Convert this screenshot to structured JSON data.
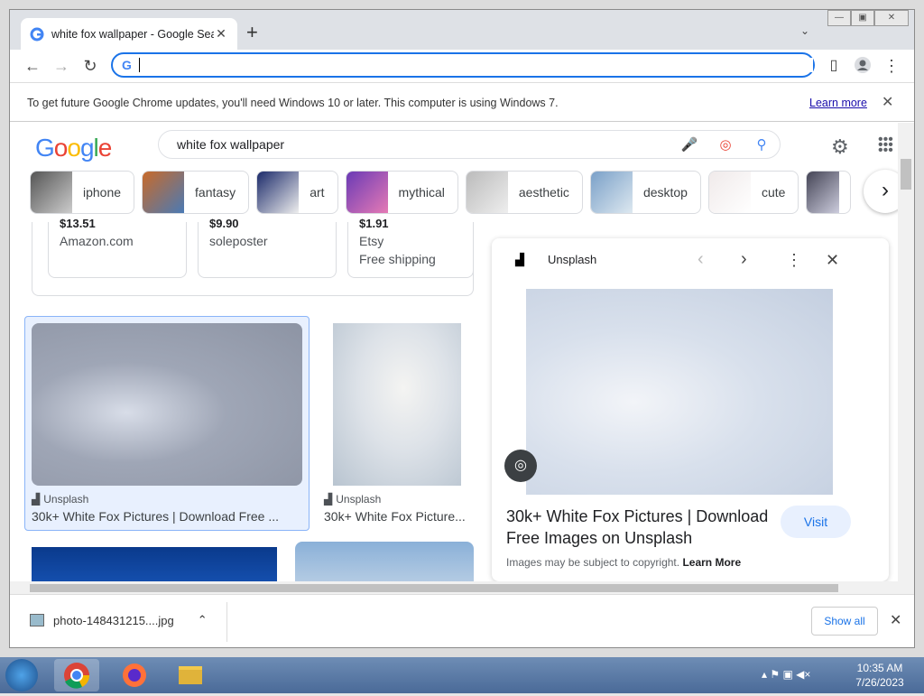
{
  "browser": {
    "tab_title": "white fox wallpaper - Google Sea",
    "omnibox_value": "",
    "infobar_message": "To get future Google Chrome updates, you'll need Windows 10 or later. This computer is using Windows 7.",
    "infobar_link": "Learn more"
  },
  "search": {
    "logo": "Google",
    "query": "white fox wallpaper",
    "chips": [
      {
        "label": "iphone"
      },
      {
        "label": "fantasy"
      },
      {
        "label": "art"
      },
      {
        "label": "mythical"
      },
      {
        "label": "aesthetic"
      },
      {
        "label": "desktop"
      },
      {
        "label": "cute"
      }
    ]
  },
  "shopping": [
    {
      "price": "$13.51",
      "store": "Amazon.com",
      "ship": ""
    },
    {
      "price": "$9.90",
      "store": "soleposter",
      "ship": ""
    },
    {
      "price": "$1.91",
      "store": "Etsy",
      "ship": "Free shipping"
    }
  ],
  "results": [
    {
      "source": "Unsplash",
      "title": "30k+ White Fox Pictures | Download Free ..."
    },
    {
      "source": "Unsplash",
      "title": "30k+ White Fox Picture..."
    }
  ],
  "panel": {
    "source": "Unsplash",
    "title": "30k+ White Fox Pictures | Download Free Images on Unsplash",
    "visit": "Visit",
    "copyright": "Images may be subject to copyright.",
    "learn_more": "Learn More"
  },
  "downloads": {
    "file": "photo-148431215....jpg",
    "show_all": "Show all"
  },
  "taskbar": {
    "time": "10:35 AM",
    "date": "7/26/2023"
  }
}
